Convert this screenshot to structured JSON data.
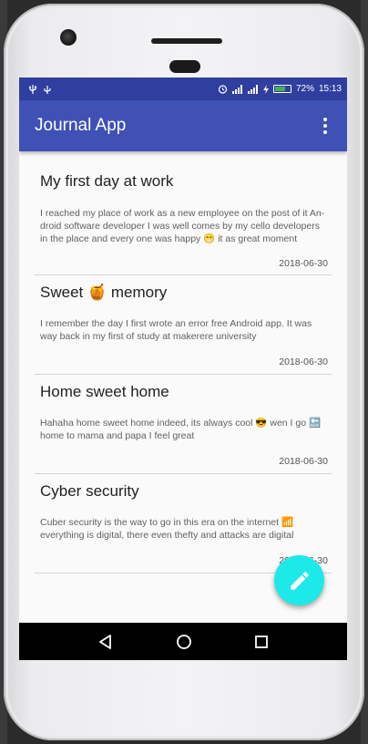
{
  "status_bar": {
    "left_icons": [
      "usb-icon",
      "usb-debug-icon"
    ],
    "right_icons": [
      "alarm-icon",
      "signal-icon",
      "signal-icon",
      "charging-icon"
    ],
    "battery_percent": "72%",
    "battery_level": 0.72,
    "time": "15:13"
  },
  "app_bar": {
    "title": "Journal App",
    "menu_icon": "overflow-menu-icon"
  },
  "entries": [
    {
      "title": "My first day at work",
      "body": "I reached my place of work as a new employee on the post of it An-droid software developer I was well comes by my cello developers in the place and every one was happy 😁 it as great moment",
      "date": "2018-06-30"
    },
    {
      "title": "Sweet 🍯  memory",
      "body": "I remember  the day I first wrote an error free Android app.  It was way back in my first of study at makerere university",
      "date": "2018-06-30"
    },
    {
      "title": "Home sweet home",
      "body": "Hahaha home sweet home indeed, its always cool 😎 wen I go 🔙 home to mama and papa I feel great",
      "date": "2018-06-30"
    },
    {
      "title": "Cyber security",
      "body": "Cuber security is the way to go in this era on the internet  📶 everything is digital, there even thefty  and attacks are digital",
      "date": "2018-06-30"
    }
  ],
  "fab": {
    "icon": "edit-pencil-icon"
  },
  "nav_bar": {
    "back": "back-icon",
    "home": "home-icon",
    "recents": "recents-icon"
  },
  "colors": {
    "primary": "#3f51b5",
    "primary_dark": "#303f9f",
    "accent": "#1de9e9"
  }
}
